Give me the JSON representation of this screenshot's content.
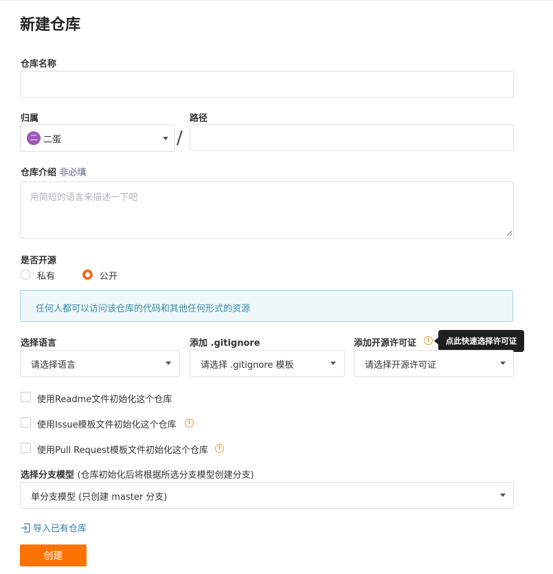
{
  "page_title": "新建仓库",
  "repo_name": {
    "label": "仓库名称",
    "value": ""
  },
  "owner": {
    "label": "归属",
    "avatar_text": "二",
    "selected": "二蛋"
  },
  "separator": "/",
  "path": {
    "label": "路径",
    "value": ""
  },
  "description": {
    "label": "仓库介绍",
    "optional_tag": "非必填",
    "placeholder": "用简短的语言来描述一下吧"
  },
  "visibility": {
    "label": "是否开源",
    "options": [
      {
        "label": "私有",
        "selected": false
      },
      {
        "label": "公开",
        "selected": true
      }
    ],
    "notice": "任何人都可以访问该仓库的代码和其他任何形式的资源"
  },
  "language": {
    "label": "选择语言",
    "selected": "请选择语言"
  },
  "gitignore": {
    "label": "添加 .gitignore",
    "selected": "请选择 .gitignore 模板"
  },
  "license": {
    "label": "添加开源许可证",
    "selected": "请选择开源许可证",
    "tooltip": "点此快速选择许可证"
  },
  "checkboxes": [
    {
      "label": "使用Readme文件初始化这个仓库",
      "checked": false,
      "has_info": false
    },
    {
      "label": "使用Issue模板文件初始化这个仓库",
      "checked": false,
      "has_info": true
    },
    {
      "label": "使用Pull Request模板文件初始化这个仓库",
      "checked": false,
      "has_info": true
    }
  ],
  "branch_model": {
    "label": "选择分支模型",
    "hint": "(仓库初始化后将根据所选分支模型创建分支)",
    "selected": "单分支模型 (只创建 master 分支)"
  },
  "import_link": "导入已有仓库",
  "create_button": "创建",
  "colors": {
    "accent": "#fe7300",
    "notice_bg": "#eef8fb",
    "link": "#2f7dac",
    "info": "#f39c3d"
  },
  "icons": {
    "info": "info-icon",
    "import": "import-icon",
    "dropdown": "chevron-down-icon"
  }
}
